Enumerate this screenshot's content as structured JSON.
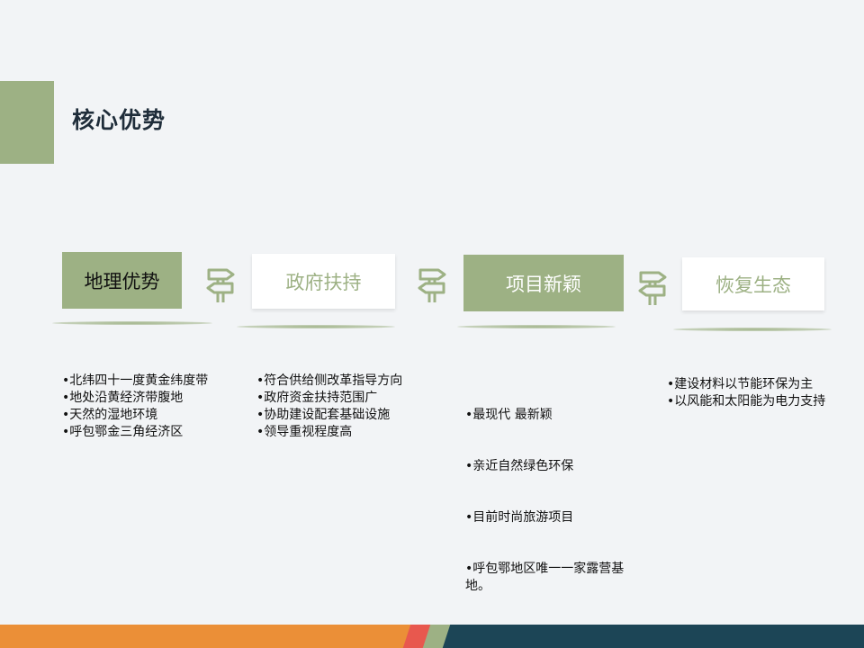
{
  "title": "核心优势",
  "colors": {
    "accent_green": "#9db184",
    "title_color": "#1f2d3a",
    "footer_orange": "#eb8f37",
    "footer_red": "#e8584e",
    "footer_green": "#9db184",
    "footer_navy": "#1c4556"
  },
  "steps": [
    {
      "label": "地理优势",
      "style": "filled",
      "bullets": [
        "•北纬四十一度黄金纬度带",
        "•地处沿黄经济带腹地",
        "•天然的湿地环境",
        "•呼包鄂金三角经济区"
      ]
    },
    {
      "label": "政府扶持",
      "style": "outline",
      "bullets": [
        "•符合供给侧改革指导方向",
        "•政府资金扶持范围广",
        "•协助建设配套基础设施",
        "•领导重视程度高"
      ]
    },
    {
      "label": "项目新颖",
      "style": "filled",
      "bullets": [
        "•最现代  最新颖",
        "•亲近自然绿色环保",
        "•目前时尚旅游项目",
        "•呼包鄂地区唯一一家露营基地。"
      ]
    },
    {
      "label": "恢复生态",
      "style": "outline",
      "bullets": [
        "•建设材料以节能环保为主",
        "•以风能和太阳能为电力支持"
      ]
    }
  ],
  "connector_icon": "signpost-icon"
}
